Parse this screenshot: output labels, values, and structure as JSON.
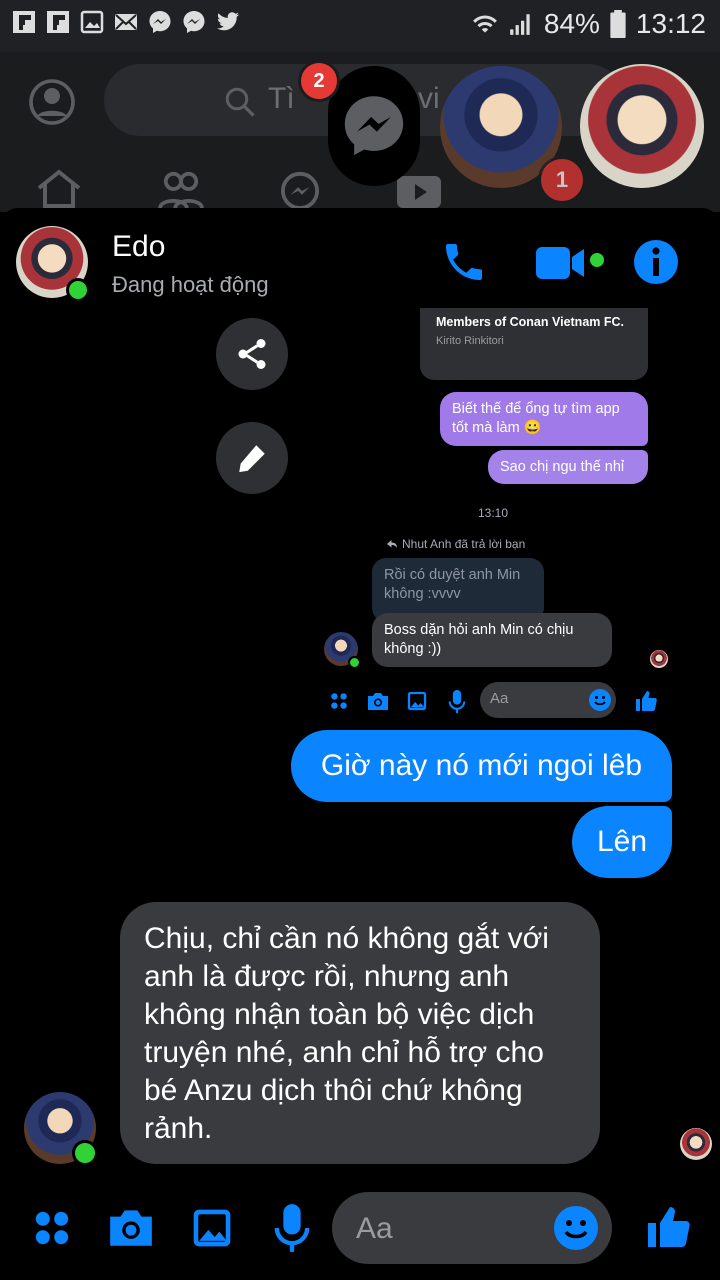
{
  "status_bar": {
    "battery": "84%",
    "time": "13:12",
    "notification_icons": [
      "flipboard-icon",
      "flipboard-icon",
      "gallery-icon",
      "mail-icon",
      "messenger-icon",
      "messenger-icon",
      "twitter-icon"
    ]
  },
  "background_app": {
    "search_placeholder_partial": "Tì",
    "search_placeholder_partial_2": "vi",
    "messenger_badge": "2",
    "chathead_badge": "1"
  },
  "chat": {
    "contact_name": "Edo",
    "contact_status": "Đang hoạt động"
  },
  "embedded": {
    "quoted_title": "Members of Conan Vietnam FC.",
    "quoted_author": "Kirito Rinkitori",
    "sent_1": "Biết thế để ổng tự tìm app tốt mà làm 😀",
    "sent_2": "Sao chị ngu thế nhỉ",
    "timestamp": "13:10",
    "reply_label": "Nhut Anh đã trả lời bạn",
    "reply_quote": "Rồi có duyệt anh Min không :vvvv",
    "reply_message": "Boss dặn hỏi anh Min có chịu không :))",
    "composer_placeholder": "Aa"
  },
  "messages": {
    "sent_1": "Giờ này nó mới ngoi lêb",
    "sent_2": "Lên",
    "received_1": "Chịu, chỉ cần nó không gắt với anh là được rồi, nhưng anh không nhận toàn bộ việc dịch truyện nhé, anh chỉ hỗ trợ cho bé Anzu dịch thôi chứ không rảnh."
  },
  "composer": {
    "placeholder": "Aa"
  },
  "colors": {
    "accent_blue": "#0a84ff",
    "sent_bubble": "#0a84ff",
    "received_bubble": "#3a3b3e",
    "embedded_sent": "#9f7ae8",
    "online_green": "#31d236"
  }
}
